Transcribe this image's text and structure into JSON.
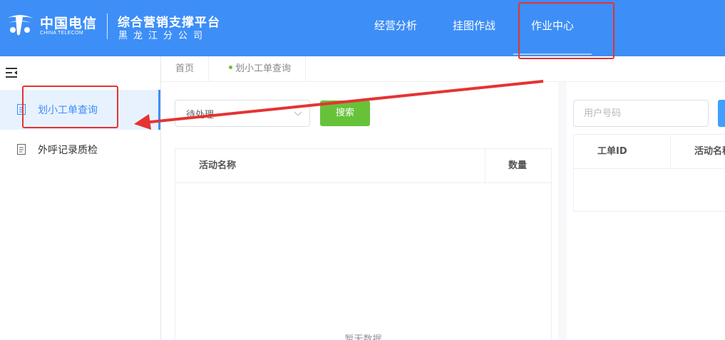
{
  "header": {
    "logo_cn": "中国电信",
    "logo_en": "CHINA TELECOM",
    "platform": "综合营销支撑平台",
    "region": "黑龙江分公司",
    "background": "#3d8ef7",
    "nav": [
      {
        "label": "经营分析",
        "active": false
      },
      {
        "label": "挂图作战",
        "active": false
      },
      {
        "label": "作业中心",
        "active": true
      }
    ]
  },
  "sidebar": {
    "collapse_icon": "menu-fold-icon",
    "items": [
      {
        "label": "划小工单查询",
        "icon": "document-icon",
        "active": true
      },
      {
        "label": "外呼记录质检",
        "icon": "document-icon",
        "active": false
      }
    ]
  },
  "tabs": [
    {
      "label": "首页"
    },
    {
      "label": "划小工单查询",
      "active": true
    }
  ],
  "left_panel": {
    "status_select": {
      "value": "待处理"
    },
    "search_button": "搜索",
    "columns": [
      "活动名称",
      "数量"
    ],
    "rows": [],
    "empty_text": "暂无数据"
  },
  "right_panel": {
    "phone_input": {
      "placeholder": "用户号码",
      "value": ""
    },
    "columns": [
      "工单ID",
      "活动名称"
    ],
    "rows": []
  },
  "colors": {
    "primary": "#3d8ef7",
    "success": "#67c23a",
    "annotation": "#e53333"
  }
}
